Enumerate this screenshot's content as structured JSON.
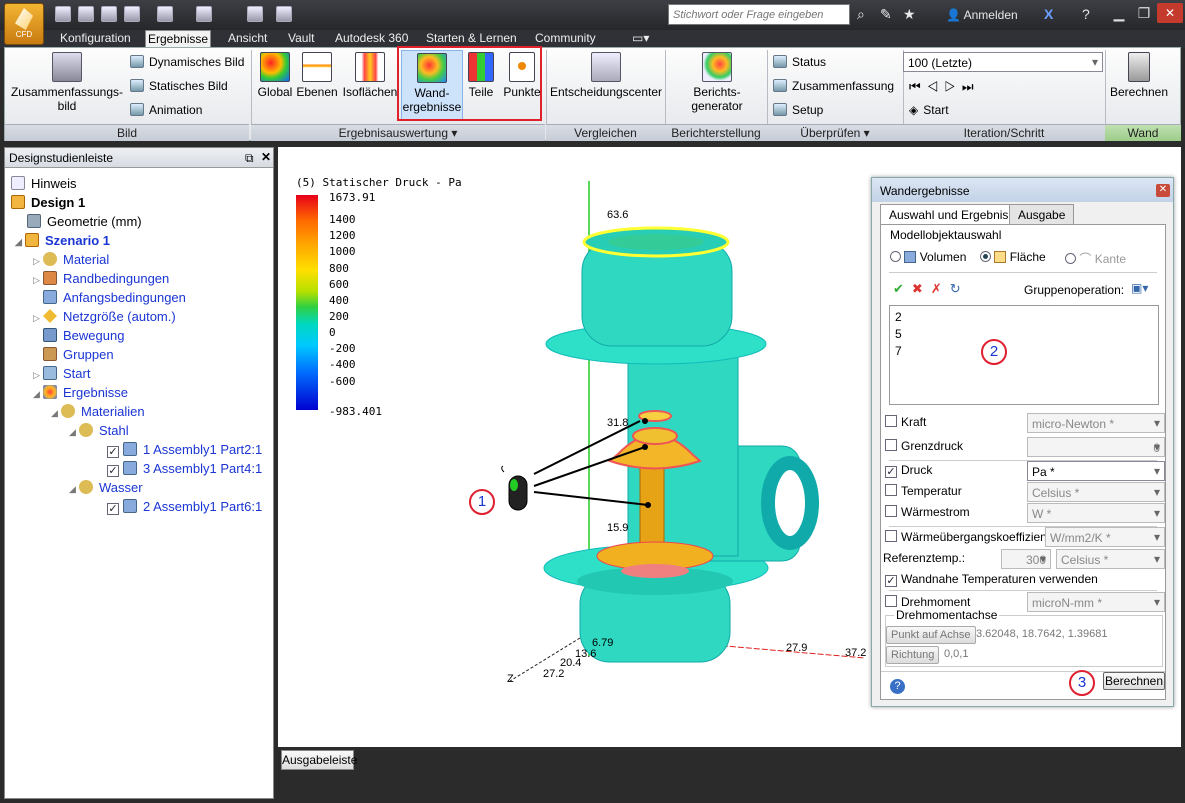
{
  "app": {
    "badge": "CFD",
    "search_placeholder": "Stichwort oder Frage eingeben",
    "signin": "Anmelden"
  },
  "tabs": [
    "Konfiguration",
    "Ergebnisse",
    "Ansicht",
    "Vault",
    "Autodesk 360",
    "Starten & Lernen",
    "Community"
  ],
  "active_tab": "Ergebnisse",
  "ribbon": {
    "bild": {
      "label": "Bild",
      "summary_line1": "Zusammenfassungs-",
      "summary_line2": "bild",
      "dynamic": "Dynamisches Bild",
      "static": "Statisches Bild",
      "animation": "Animation"
    },
    "ergebnis": {
      "label": "Ergebnisauswertung",
      "global": "Global",
      "ebenen": "Ebenen",
      "isoflaechen": "Isoflächen",
      "wand_line1": "Wand-",
      "wand_line2": "ergebnisse",
      "teile": "Teile",
      "punkte": "Punkte"
    },
    "vergleichen": {
      "label": "Vergleichen",
      "center": "Entscheidungscenter"
    },
    "bericht": {
      "label": "Berichterstellung",
      "line1": "Berichts-",
      "line2": "generator"
    },
    "ueberpruefen": {
      "label": "Überprüfen",
      "status": "Status",
      "zusammenfassung": "Zusammenfassung",
      "setup": "Setup"
    },
    "iteration": {
      "label": "Iteration/Schritt",
      "selector": "100 (Letzte)",
      "start": "Start"
    },
    "wand": {
      "label": "Wand",
      "berechnen": "Berechnen"
    }
  },
  "designpanel": {
    "title": "Designstudienleiste",
    "items": [
      {
        "label": "Hinweis"
      },
      {
        "label": "Design 1"
      },
      {
        "label": "Geometrie (mm)"
      },
      {
        "label": "Szenario 1"
      },
      {
        "label": "Material"
      },
      {
        "label": "Randbedingungen"
      },
      {
        "label": "Anfangsbedingungen"
      },
      {
        "label": "Netzgröße (autom.)"
      },
      {
        "label": "Bewegung"
      },
      {
        "label": "Gruppen"
      },
      {
        "label": "Start"
      },
      {
        "label": "Ergebnisse"
      },
      {
        "label": "Materialien"
      },
      {
        "label": "Stahl"
      },
      {
        "label": "1 Assembly1  Part2:1"
      },
      {
        "label": "3 Assembly1  Part4:1"
      },
      {
        "label": "Wasser"
      },
      {
        "label": "2 Assembly1  Part6:1"
      }
    ]
  },
  "legend": {
    "title": "(5) Statischer Druck - Pa",
    "values": [
      "1673.91",
      "1400",
      "1200",
      "1000",
      "800",
      "600",
      "400",
      "200",
      "0",
      "-200",
      "-400",
      "-600",
      "-983.401"
    ]
  },
  "axes": {
    "y_top": "63.6",
    "y_mid": "31.8",
    "y_low": "15.9",
    "z1": "6.79",
    "z2": "13.6",
    "z3": "20.4",
    "z4": "27.2",
    "x1": "27.9",
    "x2": "37.2",
    "z_label": "Z"
  },
  "callouts": {
    "one": "1",
    "two": "2",
    "three": "3"
  },
  "dialog": {
    "title": "Wandergebnisse",
    "tab1": "Auswahl und Ergebnis",
    "tab2": "Ausgabe",
    "section": "Modellobjektauswahl",
    "volumen": "Volumen",
    "flaeche": "Fläche",
    "kante": "Kante",
    "gruppenop": "Gruppenoperation:",
    "selected": [
      "2",
      "5",
      "7"
    ],
    "kraft": "Kraft",
    "kraft_unit": "micro-Newton *",
    "grenzdruck": "Grenzdruck",
    "grenzdruck_val": "0",
    "druck": "Druck",
    "druck_unit": "Pa *",
    "temperatur": "Temperatur",
    "temp_unit": "Celsius *",
    "waermestrom": "Wärmestrom",
    "ws_unit": "W *",
    "wue": "Wärmeübergangskoeffizient",
    "wue_unit": "W/mm2/K *",
    "reftemp": "Referenztemp.:",
    "reftemp_val": "300",
    "reftemp_unit": "Celsius *",
    "wandnah": "Wandnahe Temperaturen verwenden",
    "drehmoment": "Drehmoment",
    "dm_unit": "microN-mm *",
    "achse": "Drehmomentachse",
    "punkt_btn": "Punkt auf Achse",
    "punkt_val": "3.62048, 18.7642, 1.39681",
    "richtung_btn": "Richtung",
    "richtung_val": "0,0,1",
    "berechnen": "Berechnen"
  },
  "ausgabe": "Ausgabeleiste"
}
